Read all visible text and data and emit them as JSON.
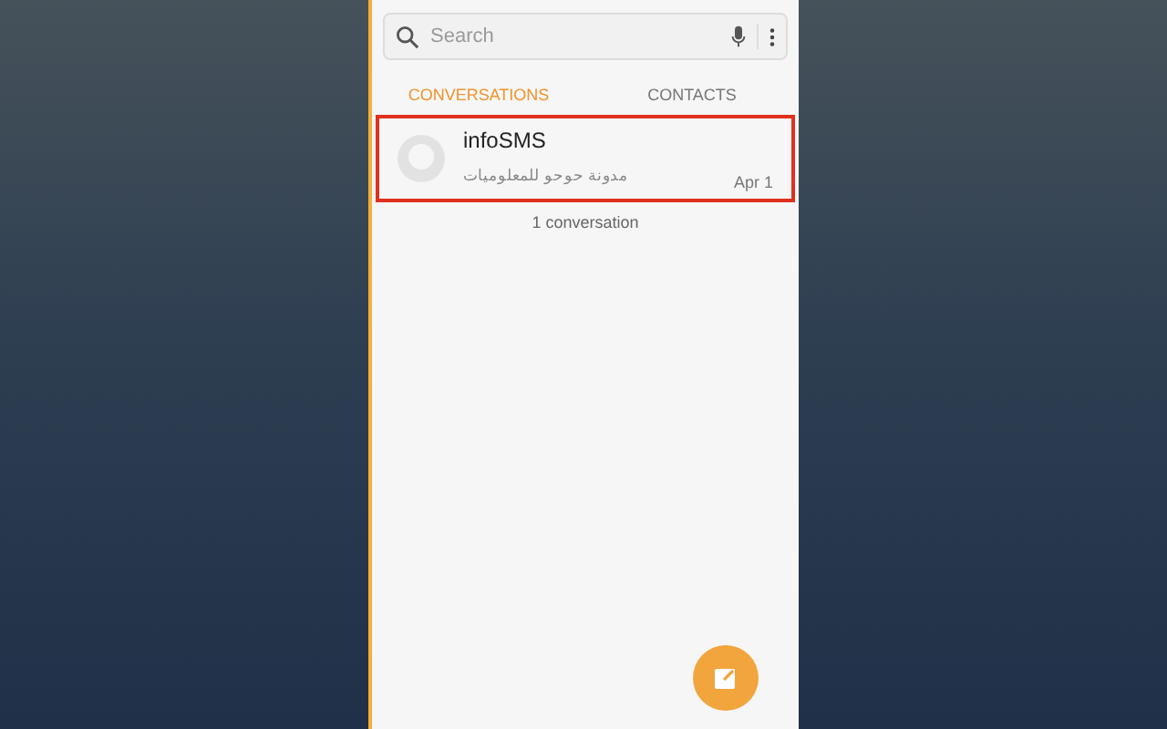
{
  "search": {
    "placeholder": "Search"
  },
  "tabs": [
    {
      "label": "CONVERSATIONS",
      "selected": true
    },
    {
      "label": "CONTACTS",
      "selected": false
    }
  ],
  "conversations": [
    {
      "name": "infoSMS",
      "preview": "مدونة حوحو للمعلوميات",
      "date": "Apr 1",
      "highlighted": true
    }
  ],
  "count": "1 conversation"
}
